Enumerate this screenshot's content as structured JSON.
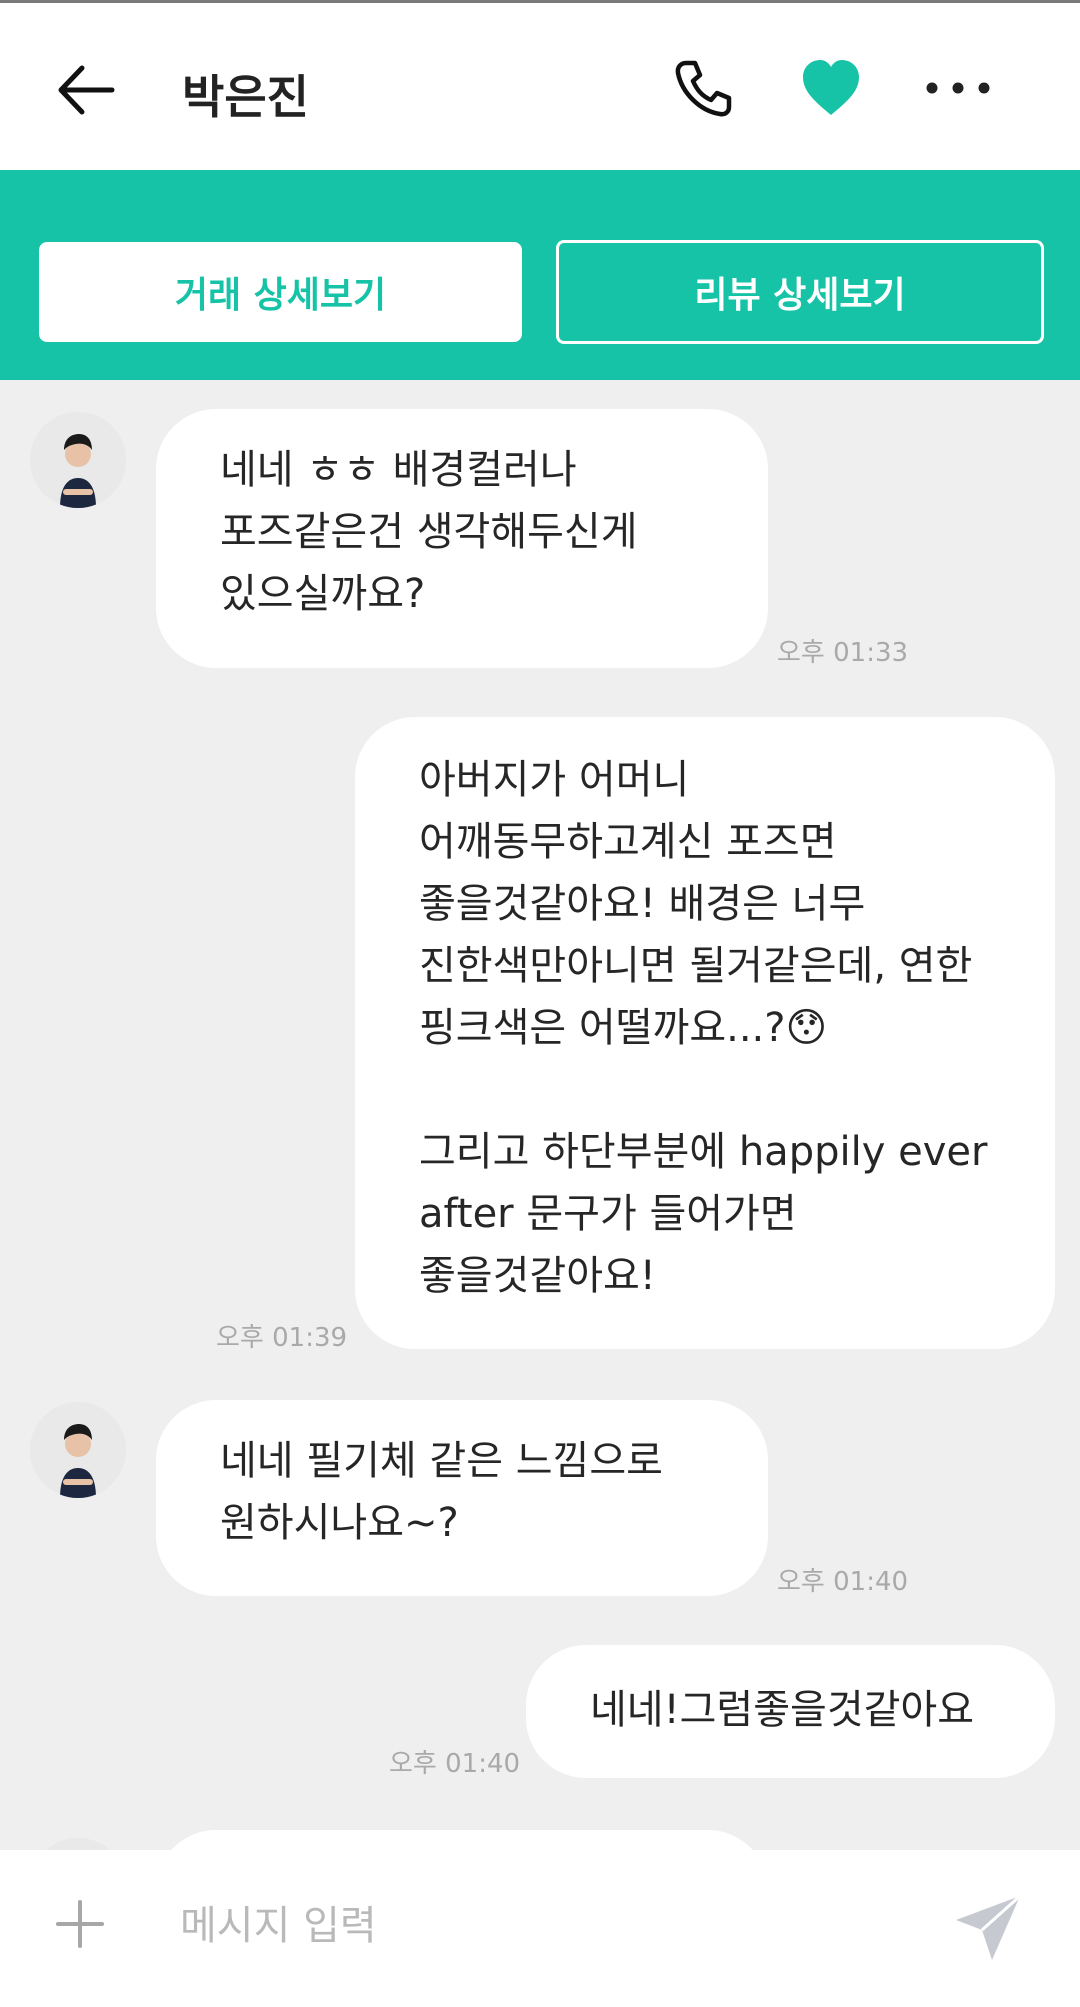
{
  "header": {
    "title": "박은진",
    "icons": {
      "back": "arrow-left-icon",
      "call": "phone-icon",
      "favorite": "heart-icon",
      "more": "more-dots-icon"
    },
    "favorite_color": "#17c3a7"
  },
  "actions": {
    "deal_details": "거래 상세보기",
    "review_details": "리뷰 상세보기",
    "band_color": "#17c3a7"
  },
  "messages": [
    {
      "sender": "other",
      "text": "네네 ㅎㅎ 배경컬러나\n포즈같은건 생각해두신게\n있으실까요?",
      "time": "오후 01:33"
    },
    {
      "sender": "me",
      "text": "아버지가 어머니\n어깨동무하고계신 포즈면\n좋을것같아요! 배경은 너무\n진한색만아니면 될거같은데, 연한\n핑크색은 어떨까요...?😯\n\n그리고 하단부분에 happily ever\nafter 문구가 들어가면\n좋을것같아요!",
      "time": "오후 01:39"
    },
    {
      "sender": "other",
      "text": "네네 필기체 같은 느낌으로\n원하시나요~?",
      "time": "오후 01:40"
    },
    {
      "sender": "me",
      "text": "네네!그럼좋을것같아요",
      "time": "오후 01:40"
    }
  ],
  "composer": {
    "placeholder": "메시지 입력",
    "icons": {
      "attach": "plus-icon",
      "send": "paper-plane-icon"
    }
  }
}
